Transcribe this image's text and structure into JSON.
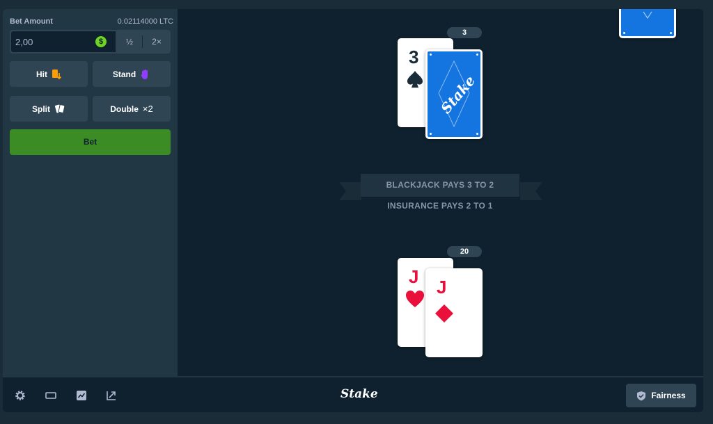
{
  "sidebar": {
    "bet_amount_label": "Bet Amount",
    "balance": "0.02114000 LTC",
    "amount_value": "2,00",
    "currency_symbol": "$",
    "half_label": "½",
    "double_label": "2×",
    "actions": {
      "hit": "Hit",
      "stand": "Stand",
      "split": "Split",
      "double": "Double",
      "double_multiplier": "×2"
    },
    "bet_label": "Bet"
  },
  "board": {
    "dealer": {
      "score": "3",
      "cards": [
        {
          "rank": "3",
          "suit": "spades",
          "color": "#0f212e"
        },
        {
          "rank": "",
          "suit": "back",
          "color": "#1475e1"
        }
      ]
    },
    "player": {
      "score": "20",
      "cards": [
        {
          "rank": "J",
          "suit": "hearts",
          "color": "#e9113c"
        },
        {
          "rank": "J",
          "suit": "diamonds",
          "color": "#e9113c"
        }
      ]
    },
    "banner_top": "BLACKJACK PAYS 3 TO 2",
    "banner_bottom": "INSURANCE PAYS 2 TO 1",
    "card_back_logo": "Stake"
  },
  "footer": {
    "icons": [
      "gear-icon",
      "theatre-mode-icon",
      "stats-chart-icon",
      "popout-icon"
    ],
    "logo": "Stake",
    "fairness_label": "Fairness"
  },
  "colors": {
    "background": "#1a2c38",
    "sidebar": "#213743",
    "board": "#0f212e",
    "button": "#2f4553",
    "bet_button": "#3c8c26",
    "card_back": "#1475e1",
    "red_suit": "#e9113c"
  }
}
